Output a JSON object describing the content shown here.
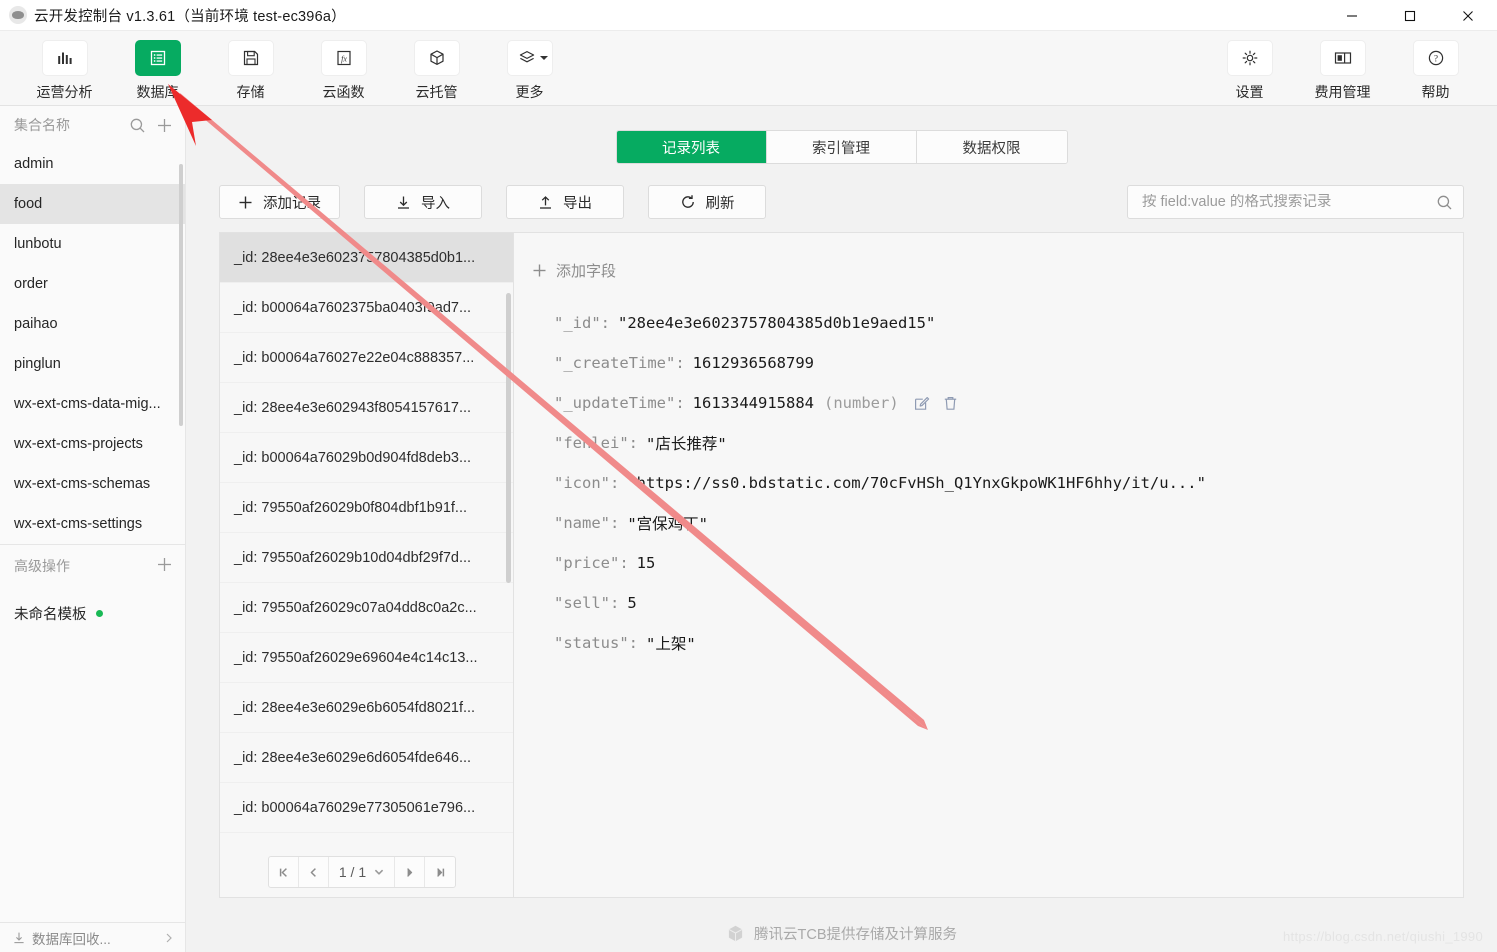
{
  "window": {
    "title": "云开发控制台 v1.3.61（当前环境 test-ec396a）",
    "logo_icon": "cloudbase-logo-icon",
    "minimize_label": "minimize",
    "maximize_label": "maximize",
    "close_label": "close"
  },
  "toolbar": {
    "left_items": [
      {
        "label": "运营分析",
        "icon": "bar-chart-icon",
        "active": false
      },
      {
        "label": "数据库",
        "icon": "database-list-icon",
        "active": true
      },
      {
        "label": "存储",
        "icon": "floppy-save-icon",
        "active": false
      },
      {
        "label": "云函数",
        "icon": "fx-function-icon",
        "active": false
      },
      {
        "label": "云托管",
        "icon": "cube-hosting-icon",
        "active": false
      },
      {
        "label": "更多",
        "icon": "layers-more-icon",
        "active": false,
        "has_caret": true
      }
    ],
    "right_items": [
      {
        "label": "设置",
        "icon": "gear-icon"
      },
      {
        "label": "费用管理",
        "icon": "billing-panel-icon"
      },
      {
        "label": "帮助",
        "icon": "question-circle-icon"
      }
    ]
  },
  "sidebar": {
    "header": {
      "title": "集合名称",
      "search_icon": "search-icon",
      "add_icon": "plus-icon"
    },
    "collections": [
      {
        "label": "admin",
        "selected": false
      },
      {
        "label": "food",
        "selected": true
      },
      {
        "label": "lunbotu",
        "selected": false
      },
      {
        "label": "order",
        "selected": false
      },
      {
        "label": "paihao",
        "selected": false
      },
      {
        "label": "pinglun",
        "selected": false
      },
      {
        "label": "wx-ext-cms-data-mig...",
        "selected": false
      },
      {
        "label": "wx-ext-cms-projects",
        "selected": false
      },
      {
        "label": "wx-ext-cms-schemas",
        "selected": false
      },
      {
        "label": "wx-ext-cms-settings",
        "selected": false
      }
    ],
    "advanced": {
      "title": "高级操作",
      "add_icon": "plus-icon"
    },
    "template": {
      "label": "未命名模板",
      "status_color": "#19b955"
    },
    "footer": {
      "label": "数据库回收...",
      "icon": "recycle-icon",
      "chevron": "chevron-right-icon"
    }
  },
  "main": {
    "tabs": [
      {
        "label": "记录列表",
        "active": true
      },
      {
        "label": "索引管理",
        "active": false
      },
      {
        "label": "数据权限",
        "active": false
      }
    ],
    "actions": [
      {
        "label": "添加记录",
        "icon": "plus-icon"
      },
      {
        "label": "导入",
        "icon": "download-icon"
      },
      {
        "label": "导出",
        "icon": "upload-icon"
      },
      {
        "label": "刷新",
        "icon": "refresh-icon"
      }
    ],
    "search": {
      "placeholder": "按 field:value 的格式搜索记录",
      "value": "",
      "icon": "search-icon"
    },
    "records": [
      {
        "label": "_id: 28ee4e3e6023757804385d0b1...",
        "selected": true
      },
      {
        "label": "_id: b00064a7602375ba0403f9ad7...",
        "selected": false
      },
      {
        "label": "_id: b00064a76027e22e04c888357...",
        "selected": false
      },
      {
        "label": "_id: 28ee4e3e602943f8054157617...",
        "selected": false
      },
      {
        "label": "_id: b00064a76029b0d904fd8deb3...",
        "selected": false
      },
      {
        "label": "_id: 79550af26029b0f804dbf1b91f...",
        "selected": false
      },
      {
        "label": "_id: 79550af26029b10d04dbf29f7d...",
        "selected": false
      },
      {
        "label": "_id: 79550af26029c07a04dd8c0a2c...",
        "selected": false
      },
      {
        "label": "_id: 79550af26029e69604e4c14c13...",
        "selected": false
      },
      {
        "label": "_id: 28ee4e3e6029e6b6054fd8021f...",
        "selected": false
      },
      {
        "label": "_id: 28ee4e3e6029e6d6054fde646...",
        "selected": false
      },
      {
        "label": "_id: b00064a76029e77305061e796...",
        "selected": false
      }
    ],
    "detail": {
      "add_field_label": "添加字段",
      "add_field_icon": "plus-icon",
      "fields": [
        {
          "key": "\"_id\"",
          "value": "\"28ee4e3e6023757804385d0b1e9aed15\"",
          "type": "",
          "hovered": false
        },
        {
          "key": "\"_createTime\"",
          "value": "1612936568799",
          "type": "",
          "hovered": false
        },
        {
          "key": "\"_updateTime\"",
          "value": "1613344915884",
          "type": "(number)",
          "hovered": true,
          "edit_icon": "edit-icon",
          "delete_icon": "trash-icon"
        },
        {
          "key": "\"fenlei\"",
          "value": "\"店长推荐\"",
          "type": "",
          "hovered": false
        },
        {
          "key": "\"icon\"",
          "value": "\"https://ss0.bdstatic.com/70cFvHSh_Q1YnxGkpoWK1HF6hhy/it/u...\"",
          "type": "",
          "hovered": false
        },
        {
          "key": "\"name\"",
          "value": "\"宫保鸡丁\"",
          "type": "",
          "hovered": false
        },
        {
          "key": "\"price\"",
          "value": "15",
          "type": "",
          "hovered": false
        },
        {
          "key": "\"sell\"",
          "value": "5",
          "type": "",
          "hovered": false
        },
        {
          "key": "\"status\"",
          "value": "\"上架\"",
          "type": "",
          "hovered": false
        }
      ]
    },
    "pager": {
      "first_icon": "page-first-icon",
      "prev_icon": "page-prev-icon",
      "page_text": "1 / 1",
      "dropdown_icon": "chevron-down-icon",
      "next_icon": "page-next-icon",
      "last_icon": "page-last-icon"
    }
  },
  "footer": {
    "text": "腾讯云TCB提供存储及计算服务",
    "icon": "tcb-cube-icon"
  },
  "watermark": {
    "text": "https://blog.csdn.net/qiushi_1990"
  },
  "annotation": {
    "arrow_color": "#ec2b2b",
    "name": "red-arrow-annotation"
  },
  "theme": {
    "accent": "#06ab61",
    "bg": "#f2f2f2",
    "panel": "#f7f7f7",
    "border": "#e2e2e2"
  }
}
